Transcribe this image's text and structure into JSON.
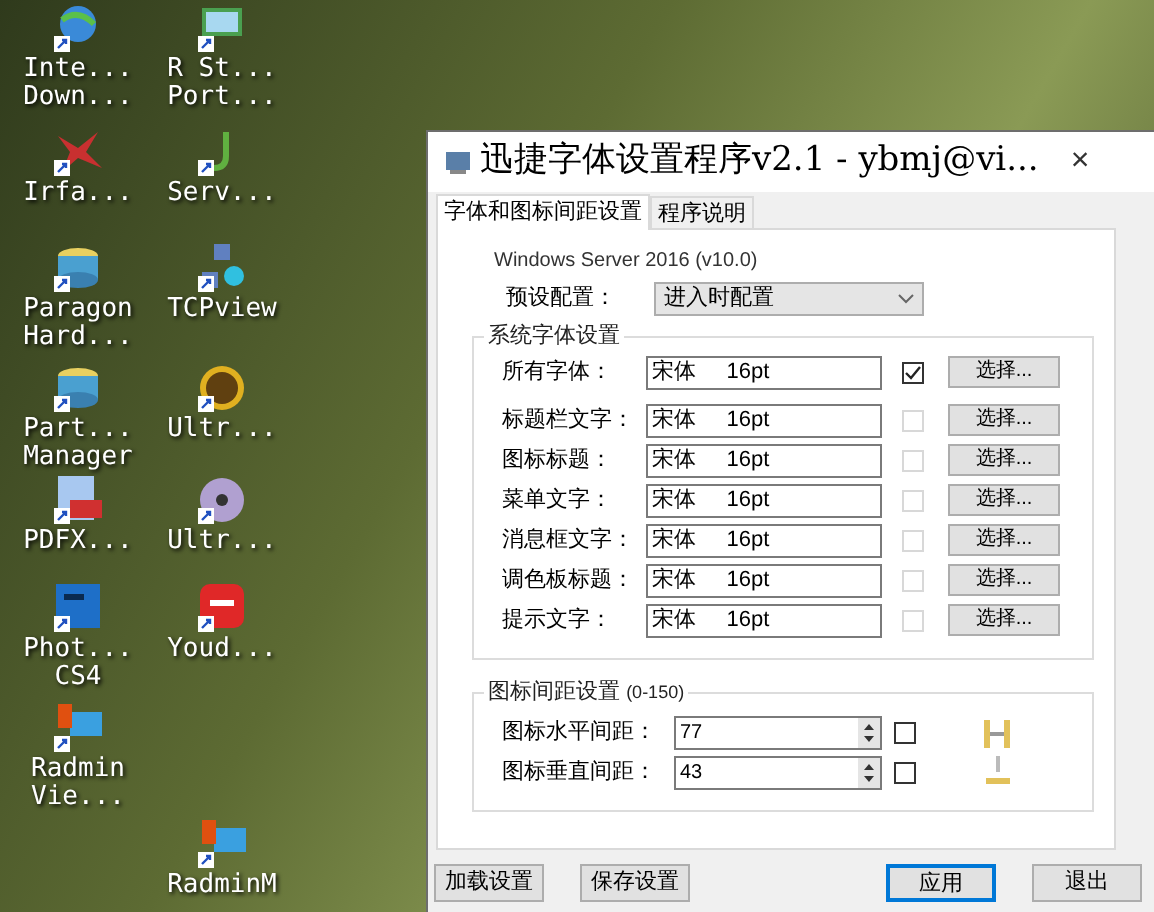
{
  "desktop_icons": [
    {
      "label": "Inte... Down...",
      "kind": "globe"
    },
    {
      "label": "R St... Port...",
      "kind": "monitor"
    },
    {
      "label": "Irfa...",
      "kind": "splat"
    },
    {
      "label": "Serv...",
      "kind": "hook"
    },
    {
      "label": "Paragon Hard...",
      "kind": "disk"
    },
    {
      "label": "TCPview",
      "kind": "network"
    },
    {
      "label": "Part... Manager",
      "kind": "disk"
    },
    {
      "label": "Ultr...",
      "kind": "ue"
    },
    {
      "label": "PDFX...",
      "kind": "pdf"
    },
    {
      "label": "Ultr...",
      "kind": "cd"
    },
    {
      "label": "Phot... CS4",
      "kind": "ps"
    },
    {
      "label": "Youd...",
      "kind": "dict"
    },
    {
      "label": "Radmin Vie...",
      "kind": "radmin"
    },
    {
      "label": "RadminM",
      "kind": "radmin"
    }
  ],
  "window": {
    "title": "迅捷字体设置程序v2.1 - ybmj@vi...",
    "close": "×"
  },
  "tabs": [
    {
      "label": "字体和图标间距设置",
      "selected": true
    },
    {
      "label": "程序说明",
      "selected": false
    }
  ],
  "os_version": "Windows Server 2016 (v10.0)",
  "preset": {
    "label": "预设配置：",
    "value": "进入时配置"
  },
  "font_group": {
    "title": "系统字体设置",
    "rows": [
      {
        "label": "所有字体：",
        "value": "宋体     16pt",
        "checked": true,
        "disabled": false,
        "button": "选择..."
      },
      {
        "label": "标题栏文字：",
        "value": "宋体     16pt",
        "checked": false,
        "disabled": true,
        "button": "选择..."
      },
      {
        "label": "图标标题：",
        "value": "宋体     16pt",
        "checked": false,
        "disabled": true,
        "button": "选择..."
      },
      {
        "label": "菜单文字：",
        "value": "宋体     16pt",
        "checked": false,
        "disabled": true,
        "button": "选择..."
      },
      {
        "label": "消息框文字：",
        "value": "宋体     16pt",
        "checked": false,
        "disabled": true,
        "button": "选择..."
      },
      {
        "label": "调色板标题：",
        "value": "宋体     16pt",
        "checked": false,
        "disabled": true,
        "button": "选择..."
      },
      {
        "label": "提示文字：",
        "value": "宋体     16pt",
        "checked": false,
        "disabled": true,
        "button": "选择..."
      }
    ]
  },
  "spacing_group": {
    "title": "图标间距设置",
    "range": "(0-150)",
    "rows": [
      {
        "label": "图标水平间距：",
        "value": "77",
        "checked": false
      },
      {
        "label": "图标垂直间距：",
        "value": "43",
        "checked": false
      }
    ]
  },
  "footer_buttons": [
    {
      "label": "加载设置",
      "default": false
    },
    {
      "label": "保存设置",
      "default": false
    },
    {
      "label": "应用",
      "default": true
    },
    {
      "label": "退出",
      "default": false
    }
  ]
}
